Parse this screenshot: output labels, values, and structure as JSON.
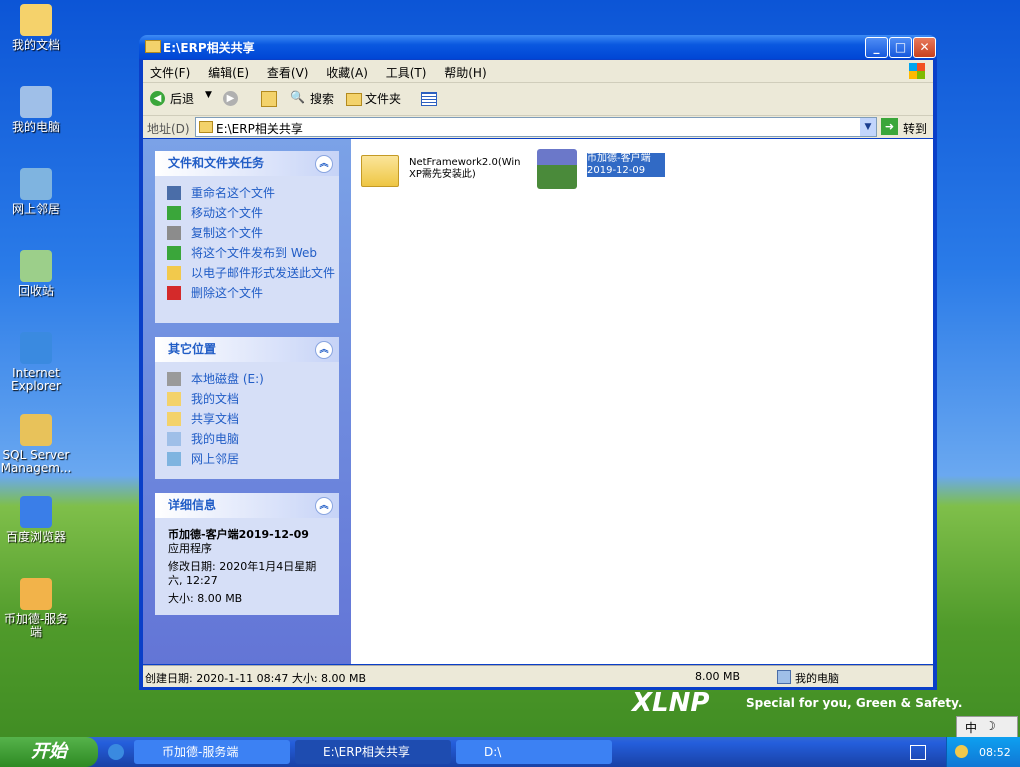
{
  "desktop": {
    "icons": [
      {
        "label": "我的文档",
        "color": "#f5d26b"
      },
      {
        "label": "我的电脑",
        "color": "#9fbfe8"
      },
      {
        "label": "网上邻居",
        "color": "#7fb4e0"
      },
      {
        "label": "回收站",
        "color": "#9ccf8a"
      },
      {
        "label": "Internet Explorer",
        "color": "#3a8ae0"
      },
      {
        "label": "SQL Server Managem...",
        "color": "#e8c25a"
      },
      {
        "label": "百度浏览器",
        "color": "#3a7ee8"
      },
      {
        "label": "币加德-服务端",
        "color": "#f2b34a"
      }
    ],
    "brand": {
      "logo": "XLNP",
      "tagline": "Special for you, Green & Safety."
    }
  },
  "window": {
    "title": "E:\\ERP相关共享",
    "menu": [
      "文件(F)",
      "编辑(E)",
      "查看(V)",
      "收藏(A)",
      "工具(T)",
      "帮助(H)"
    ],
    "toolbar": {
      "back": "后退",
      "search": "搜索",
      "folders": "文件夹"
    },
    "address": {
      "label": "地址(D)",
      "value": "E:\\ERP相关共享",
      "go": "转到"
    },
    "tasks": {
      "title": "文件和文件夹任务",
      "items": [
        "重命名这个文件",
        "移动这个文件",
        "复制这个文件",
        "将这个文件发布到 Web",
        "以电子邮件形式发送此文件",
        "删除这个文件"
      ]
    },
    "places": {
      "title": "其它位置",
      "items": [
        "本地磁盘 (E:)",
        "我的文档",
        "共享文档",
        "我的电脑",
        "网上邻居"
      ]
    },
    "details": {
      "title": "详细信息",
      "name": "币加德-客户端2019-12-09",
      "type": "应用程序",
      "modified": "修改日期: 2020年1月4日星期六, 12:27",
      "size": "大小: 8.00 MB"
    },
    "files": [
      {
        "name": "NetFramework2.0(Win XP需先安装此)",
        "kind": "folder"
      },
      {
        "name": "币加德-客户端2019-12-09",
        "kind": "installer",
        "selected": true
      }
    ],
    "status": {
      "info": "创建日期: 2020-1-11 08:47 大小: 8.00 MB",
      "size": "8.00 MB",
      "location": "我的电脑"
    }
  },
  "taskbar": {
    "start": "开始",
    "tasks": [
      "币加德-服务端",
      "E:\\ERP相关共享",
      "D:\\"
    ],
    "ime": "中",
    "clock": "08:52"
  }
}
